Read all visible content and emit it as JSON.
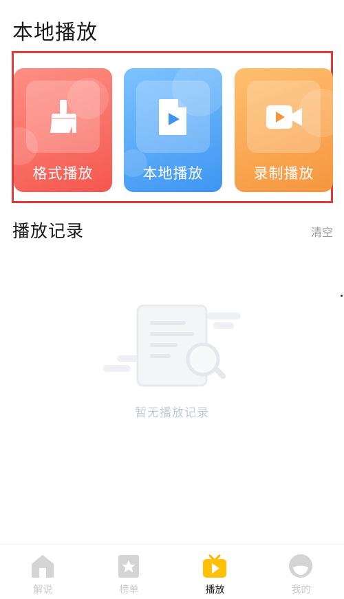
{
  "header": {
    "title": "本地播放"
  },
  "cards": [
    {
      "label": "格式播放",
      "icon": "broom-icon",
      "color": "#f4574f"
    },
    {
      "label": "本地播放",
      "icon": "video-file-icon",
      "color": "#3e95f2"
    },
    {
      "label": "录制播放",
      "icon": "video-camera-icon",
      "color": "#f5953f"
    }
  ],
  "history": {
    "title": "播放记录",
    "clear_label": "清空",
    "empty_text": "暂无播放记录",
    "empty_icon": "empty-document-search-icon"
  },
  "tabbar": {
    "active_color": "#ffc107",
    "items": [
      {
        "label": "解说",
        "icon": "home-icon",
        "active": false
      },
      {
        "label": "榜单",
        "icon": "star-list-icon",
        "active": false
      },
      {
        "label": "播放",
        "icon": "tv-play-icon",
        "active": true
      },
      {
        "label": "我的",
        "icon": "profile-icon",
        "active": false
      }
    ]
  }
}
